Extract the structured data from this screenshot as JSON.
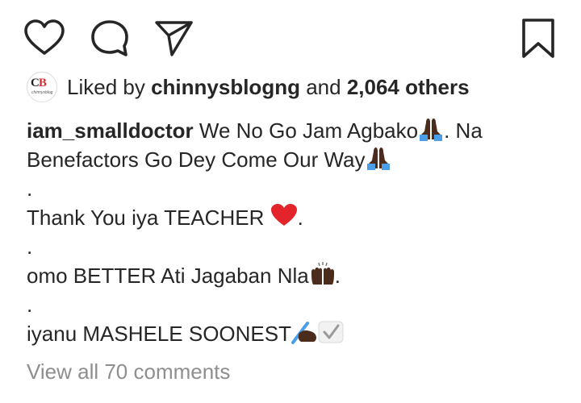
{
  "actions": {
    "like_icon": "heart-outline-icon",
    "comment_icon": "speech-bubble-icon",
    "share_icon": "paper-plane-icon",
    "save_icon": "bookmark-icon"
  },
  "likes": {
    "avatar_text_a": "C",
    "avatar_text_b": "B",
    "avatar_sub": "chinnysblog",
    "prefix": "Liked by",
    "user": "chinnysblogng",
    "middle": "and",
    "count": "2,064 others"
  },
  "caption": {
    "username": "iam_smalldoctor",
    "line1_text": "We No Go Jam Agbako",
    "line1_after": ". Na",
    "line2_text": "Benefactors Go Dey Come Our Way",
    "dot": ".",
    "line3_text": "Thank You iya TEACHER ",
    "line3_after": ".",
    "line4_text": "omo BETTER Ati Jagaban Nla",
    "line4_after": ".",
    "line5_text": "iyanu MASHELE SOONEST"
  },
  "comments": {
    "view_all": "View all 70 comments"
  },
  "colors": {
    "text": "#262626",
    "muted": "#8e8e8e",
    "heart": "#e3242b",
    "skin": "#4a2b1c",
    "sleeve": "#4a9fe8"
  }
}
